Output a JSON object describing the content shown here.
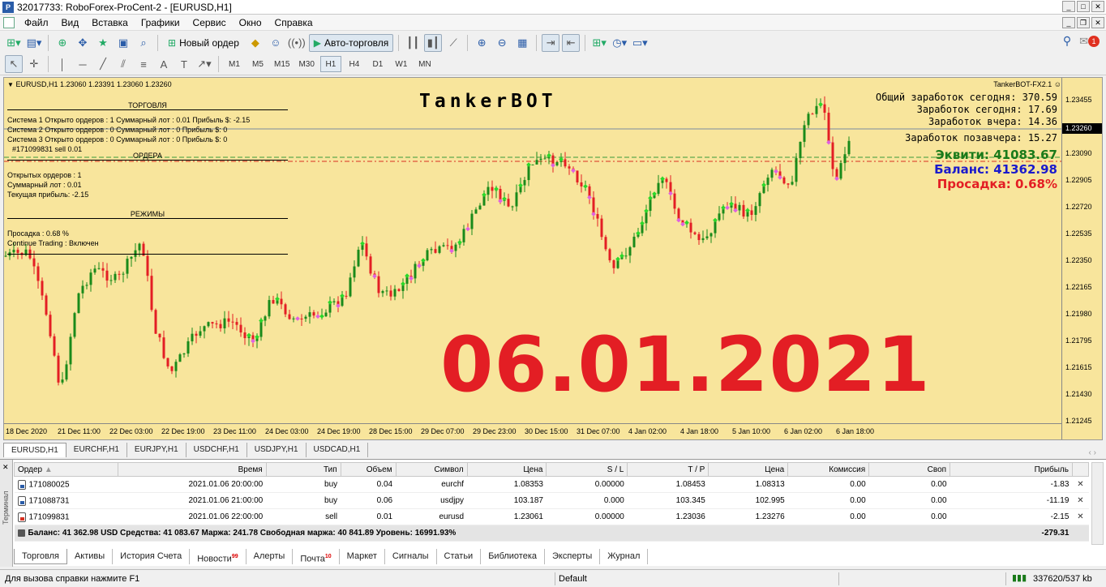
{
  "window": {
    "title": "32017733: RoboForex-ProCent-2 - [EURUSD,H1]"
  },
  "menu": [
    "Файл",
    "Вид",
    "Вставка",
    "Графики",
    "Сервис",
    "Окно",
    "Справка"
  ],
  "toolbar": {
    "new_order": "Новый ордер",
    "autotrading": "Авто-торговля",
    "timeframes": [
      "M1",
      "M5",
      "M15",
      "M30",
      "H1",
      "H4",
      "D1",
      "W1",
      "MN"
    ],
    "active_timeframe": "H1",
    "notifications_badge": "1"
  },
  "chart": {
    "symbol_line": "EURUSD,H1  1.23060 1.23391 1.23060 1.23260",
    "expert_name": "TankerBOT-FX2.1",
    "bot_title": "TankerBOT",
    "big_date": "06.01.2021",
    "panel": {
      "trading_header": "ТОРГОВЛЯ",
      "systems": [
        "Система 1 Открыто ордеров :  1   Суммарный лот :  0.01   Прибыль $: -2.15",
        "Система 2 Открыто ордеров :  0   Суммарный лот :  0   Прибыль $:  0",
        "Система 3 Открыто ордеров :  0   Суммарный лот :  0   Прибыль $:  0"
      ],
      "order_tag": "#171099831 sell 0.01",
      "orders_header": "ОРДЕРА",
      "orders_lines": [
        "Открытых ордеров :   1",
        "Суммарный лот :   0.01",
        "Текущая прибыль:   -2.15"
      ],
      "modes_header": "РЕЖИМЫ",
      "modes_lines": [
        "Просадка :   0.68 %",
        "Continue Trading :   Включен"
      ]
    },
    "stats": [
      "Общий заработок сегодня: 370.59",
      "Заработок сегодня: 17.69",
      "Заработок вчера: 14.36",
      "Заработок позавчера: 15.27"
    ],
    "equity": "Эквити: 41083.67",
    "balance": "Баланс: 41362.98",
    "drawdown": "Просадка: 0.68%",
    "colors": {
      "background": "#f8e59c",
      "equity": "#1a7a1a",
      "balance": "#1a1acc",
      "drawdown": "#e31e24",
      "big_date": "#e31e24"
    },
    "price_labels": [
      "1.23455",
      "1.23090",
      "1.22905",
      "1.22720",
      "1.22535",
      "1.22350",
      "1.22165",
      "1.21980",
      "1.21795",
      "1.21615",
      "1.21430",
      "1.21245"
    ],
    "current_price": "1.23260",
    "time_labels": [
      "18 Dec 2020",
      "21 Dec 11:00",
      "22 Dec 03:00",
      "22 Dec 19:00",
      "23 Dec 11:00",
      "24 Dec 03:00",
      "24 Dec 19:00",
      "28 Dec 15:00",
      "29 Dec 07:00",
      "29 Dec 23:00",
      "30 Dec 15:00",
      "31 Dec 07:00",
      "4 Jan 02:00",
      "4 Jan 18:00",
      "5 Jan 10:00",
      "6 Jan 02:00",
      "6 Jan 18:00"
    ]
  },
  "chart_tabs": [
    "EURUSD,H1",
    "EURCHF,H1",
    "EURJPY,H1",
    "USDCHF,H1",
    "USDJPY,H1",
    "USDCAD,H1"
  ],
  "terminal": {
    "side_label": "Терминал",
    "columns": [
      "Ордер",
      "Время",
      "Тип",
      "Объем",
      "Символ",
      "Цена",
      "S / L",
      "T / P",
      "Цена",
      "Комиссия",
      "Своп",
      "Прибыль"
    ],
    "rows": [
      {
        "order": "171080025",
        "time": "2021.01.06 20:00:00",
        "type": "buy",
        "volume": "0.04",
        "symbol": "eurchf",
        "price": "1.08353",
        "sl": "0.00000",
        "tp": "1.08453",
        "cur": "1.08313",
        "commission": "0.00",
        "swap": "0.00",
        "profit": "-1.83"
      },
      {
        "order": "171088731",
        "time": "2021.01.06 21:00:00",
        "type": "buy",
        "volume": "0.06",
        "symbol": "usdjpy",
        "price": "103.187",
        "sl": "0.000",
        "tp": "103.345",
        "cur": "102.995",
        "commission": "0.00",
        "swap": "0.00",
        "profit": "-11.19"
      },
      {
        "order": "171099831",
        "time": "2021.01.06 22:00:00",
        "type": "sell",
        "volume": "0.01",
        "symbol": "eurusd",
        "price": "1.23061",
        "sl": "0.00000",
        "tp": "1.23036",
        "cur": "1.23276",
        "commission": "0.00",
        "swap": "0.00",
        "profit": "-2.15"
      }
    ],
    "summary": "Баланс: 41 362.98 USD  Средства: 41 083.67  Маржа: 241.78  Свободная маржа: 40 841.89  Уровень: 16991.93%",
    "summary_profit": "-279.31",
    "tabs": [
      {
        "label": "Торговля",
        "badge": ""
      },
      {
        "label": "Активы",
        "badge": ""
      },
      {
        "label": "История Счета",
        "badge": ""
      },
      {
        "label": "Новости",
        "badge": "99"
      },
      {
        "label": "Алерты",
        "badge": ""
      },
      {
        "label": "Почта",
        "badge": "10"
      },
      {
        "label": "Маркет",
        "badge": ""
      },
      {
        "label": "Сигналы",
        "badge": ""
      },
      {
        "label": "Статьи",
        "badge": ""
      },
      {
        "label": "Библиотека",
        "badge": ""
      },
      {
        "label": "Эксперты",
        "badge": ""
      },
      {
        "label": "Журнал",
        "badge": ""
      }
    ]
  },
  "statusbar": {
    "help": "Для вызова справки нажмите F1",
    "profile": "Default",
    "traffic": "337620/537 kb"
  }
}
